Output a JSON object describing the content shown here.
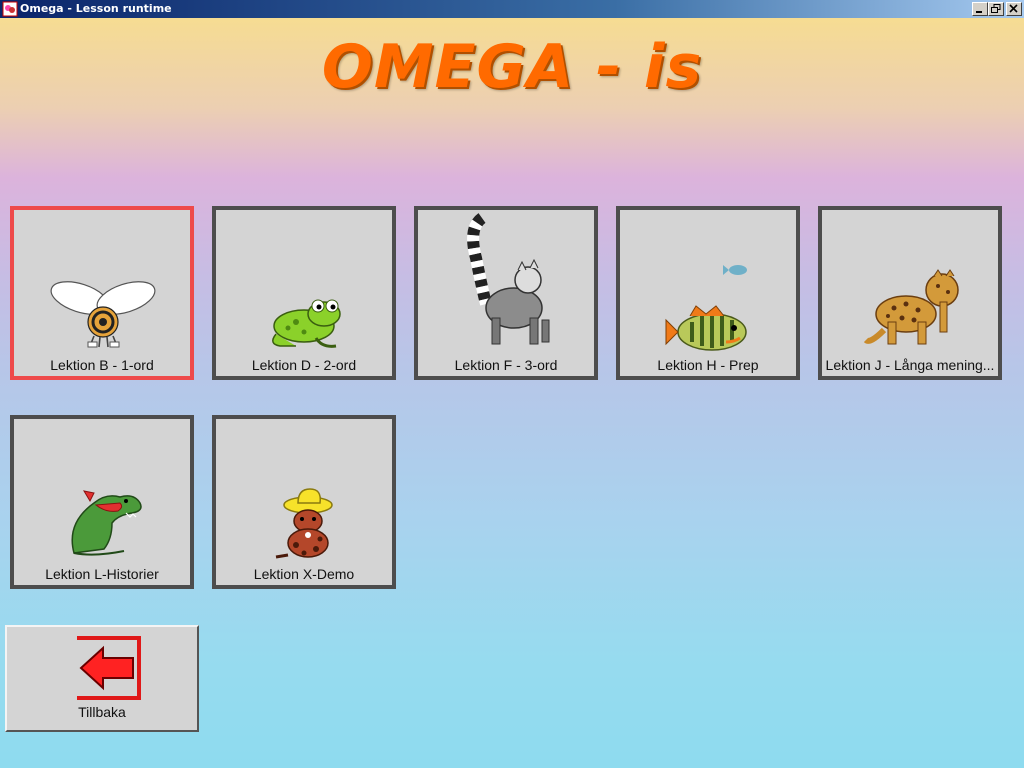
{
  "window": {
    "title": "Omega - Lesson runtime",
    "icon": "omega-app-icon",
    "controls": [
      "minimize-icon",
      "restore-icon",
      "close-icon"
    ]
  },
  "heading": "OMEGA - is",
  "lessons": [
    {
      "label": "Lektion B - 1-ord",
      "icon": "bee-icon",
      "selected": true
    },
    {
      "label": "Lektion D - 2-ord",
      "icon": "frog-icon",
      "selected": false
    },
    {
      "label": "Lektion F - 3-ord",
      "icon": "lemur-icon",
      "selected": false
    },
    {
      "label": "Lektion H - Prep",
      "icon": "fish-icon",
      "selected": false
    },
    {
      "label": "Lektion J - Långa mening...",
      "icon": "leopard-icon",
      "selected": false
    },
    {
      "label": "Lektion L-Historier",
      "icon": "dinosaur-icon",
      "selected": false
    },
    {
      "label": "Lektion X-Demo",
      "icon": "dog-cowboy-icon",
      "selected": false
    }
  ],
  "back_button": {
    "label": "Tillbaka",
    "icon": "arrow-left-icon"
  },
  "colors": {
    "heading": "#ff6a00",
    "tile_bg": "#d4d4d4",
    "tile_border": "#4d4d4d",
    "tile_selected_border": "#ee4a4a"
  }
}
